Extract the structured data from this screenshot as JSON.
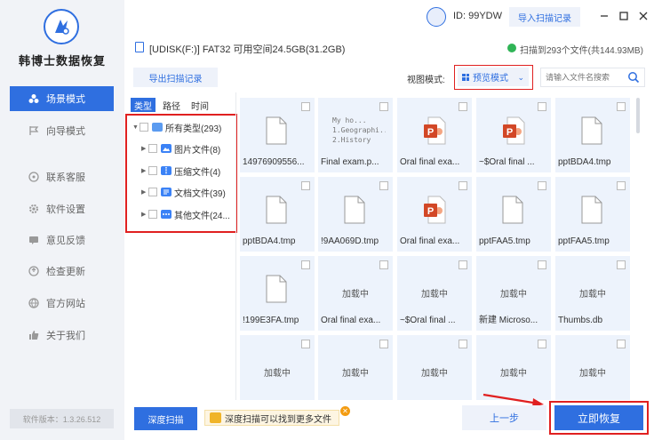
{
  "app": {
    "name": "韩博士数据恢复",
    "version": "软件版本：1.3.26.512"
  },
  "sidebar": {
    "items": [
      {
        "label": "场景模式",
        "icon": "scene-icon",
        "active": true
      },
      {
        "label": "向导模式",
        "icon": "flag-icon",
        "active": false
      },
      {
        "label": "联系客服",
        "icon": "headset-icon",
        "active": false
      },
      {
        "label": "软件设置",
        "icon": "gear-icon",
        "active": false
      },
      {
        "label": "意见反馈",
        "icon": "feedback-icon",
        "active": false
      },
      {
        "label": "检查更新",
        "icon": "update-icon",
        "active": false
      },
      {
        "label": "官方网站",
        "icon": "globe-icon",
        "active": false
      },
      {
        "label": "关于我们",
        "icon": "thumb-icon",
        "active": false
      }
    ]
  },
  "header": {
    "user_id": "ID: 99YDW",
    "import_label": "导入扫描记录",
    "drive_info": "[UDISK(F:)] FAT32 可用空间24.5GB(31.2GB)",
    "scan_status": "扫描到293个文件(共144.93MB)"
  },
  "toolbar": {
    "export_label": "导出扫描记录",
    "view_label": "视图模式:",
    "view_value": "预览模式",
    "search_placeholder": "请输入文件名搜索"
  },
  "category": {
    "tabs": [
      {
        "label": "类型",
        "active": true
      },
      {
        "label": "路径",
        "active": false
      },
      {
        "label": "时间",
        "active": false
      }
    ],
    "root": "所有类型(293)",
    "children": [
      {
        "label": "图片文件(8)",
        "icon": "image-icon",
        "color": "#3b82f6"
      },
      {
        "label": "压缩文件(4)",
        "icon": "archive-icon",
        "color": "#3b82f6"
      },
      {
        "label": "文档文件(39)",
        "icon": "document-icon",
        "color": "#3b82f6"
      },
      {
        "label": "其他文件(24...",
        "icon": "other-files-icon",
        "color": "#3b82f6"
      }
    ]
  },
  "files": [
    {
      "name": "14976909556...",
      "kind": "doc"
    },
    {
      "name": "Final exam.p...",
      "kind": "text",
      "preview": "My ho...\n1.Geographi...\n2.History"
    },
    {
      "name": "Oral final exa...",
      "kind": "ppt"
    },
    {
      "name": "~$Oral final ...",
      "kind": "ppt"
    },
    {
      "name": "pptBDA4.tmp",
      "kind": "doc"
    },
    {
      "name": "pptBDA4.tmp",
      "kind": "doc"
    },
    {
      "name": "!9AA069D.tmp",
      "kind": "doc"
    },
    {
      "name": "Oral final exa...",
      "kind": "ppt"
    },
    {
      "name": "pptFAA5.tmp",
      "kind": "doc"
    },
    {
      "name": "pptFAA5.tmp",
      "kind": "doc"
    },
    {
      "name": "!199E3FA.tmp",
      "kind": "doc"
    },
    {
      "name": "Oral final exa...",
      "kind": "loading"
    },
    {
      "name": "~$Oral final ...",
      "kind": "loading"
    },
    {
      "name": "新建 Microso...",
      "kind": "loading"
    },
    {
      "name": "Thumbs.db",
      "kind": "loading"
    },
    {
      "name": "",
      "kind": "loading"
    },
    {
      "name": "",
      "kind": "loading"
    },
    {
      "name": "",
      "kind": "loading"
    },
    {
      "name": "",
      "kind": "loading"
    },
    {
      "name": "",
      "kind": "loading"
    }
  ],
  "loading_label": "加载中",
  "bottom": {
    "deep_scan_label": "深度扫描",
    "tip": "深度扫描可以找到更多文件",
    "prev_label": "上一步",
    "recover_label": "立即恢复"
  },
  "colors": {
    "accent": "#2f6fe0",
    "highlight": "#e02020",
    "ppt": "#d24726"
  }
}
